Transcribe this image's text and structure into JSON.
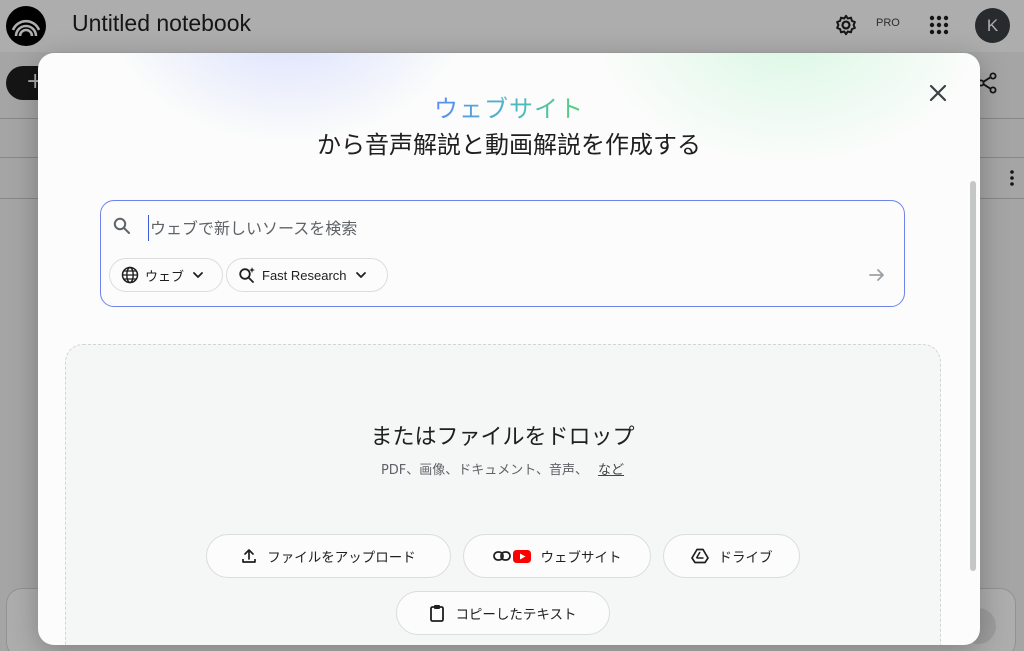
{
  "app": {
    "title": "Untitled notebook",
    "plan_badge": "PRO",
    "avatar_initial": "K",
    "icons": [
      "notebook-logo-icon",
      "settings-gear-icon",
      "apps-grid-icon",
      "share-icon",
      "more-vert-icon"
    ]
  },
  "dialog": {
    "heading_accent": "ウェブサイト",
    "heading_main": "から音声解説と動画解説を作成する",
    "search": {
      "placeholder": "ウェブで新しいソースを検索",
      "value": "",
      "source_filter": "ウェブ",
      "research_mode": "Fast Research"
    },
    "dropzone": {
      "title": "またはファイルをドロップ",
      "subtitle": "PDF、画像、ドキュメント、音声、",
      "more_link": "など"
    },
    "source_buttons": {
      "upload": "ファイルをアップロード",
      "website": "ウェブサイト",
      "drive": "ドライブ",
      "copied_text": "コピーしたテキスト"
    },
    "colors": {
      "accent_gradient": [
        "#5b8cf2",
        "#57cf7a"
      ],
      "youtube_red": "#ff0000",
      "focus_border": "#6f83e8"
    }
  }
}
